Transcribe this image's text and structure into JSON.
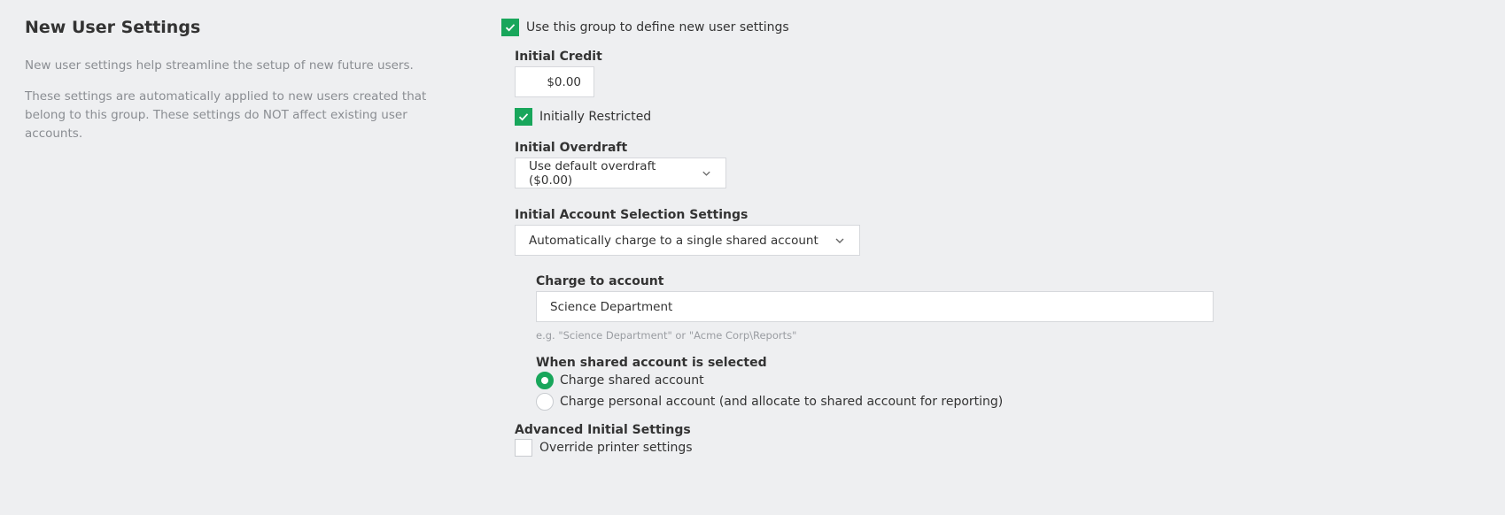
{
  "section": {
    "title": "New User Settings",
    "desc1": "New user settings help streamline the setup of new future users.",
    "desc2": "These settings are automatically applied to new users created that belong to this group. These settings do NOT affect existing user accounts."
  },
  "use_group": {
    "label": "Use this group to define new user settings",
    "checked": true
  },
  "initial_credit": {
    "label": "Initial Credit",
    "value": "$0.00"
  },
  "initially_restricted": {
    "label": "Initially Restricted",
    "checked": true
  },
  "initial_overdraft": {
    "label": "Initial Overdraft",
    "selected": "Use default overdraft ($0.00)"
  },
  "account_selection": {
    "label": "Initial Account Selection Settings",
    "selected": "Automatically charge to a single shared account"
  },
  "charge_to_account": {
    "label": "Charge to account",
    "value": "Science Department",
    "hint": "e.g. \"Science Department\" or \"Acme Corp\\Reports\""
  },
  "shared_selected": {
    "label": "When shared account is selected",
    "options": [
      {
        "label": "Charge shared account",
        "selected": true
      },
      {
        "label": "Charge personal account (and allocate to shared account for reporting)",
        "selected": false
      }
    ]
  },
  "advanced": {
    "label": "Advanced Initial Settings",
    "override_label": "Override printer settings",
    "override_checked": false
  },
  "colors": {
    "accent": "#18a65b",
    "background": "#eeeff1"
  },
  "icons": {
    "check": "check-icon",
    "dropdown": "chevron-down-icon"
  }
}
